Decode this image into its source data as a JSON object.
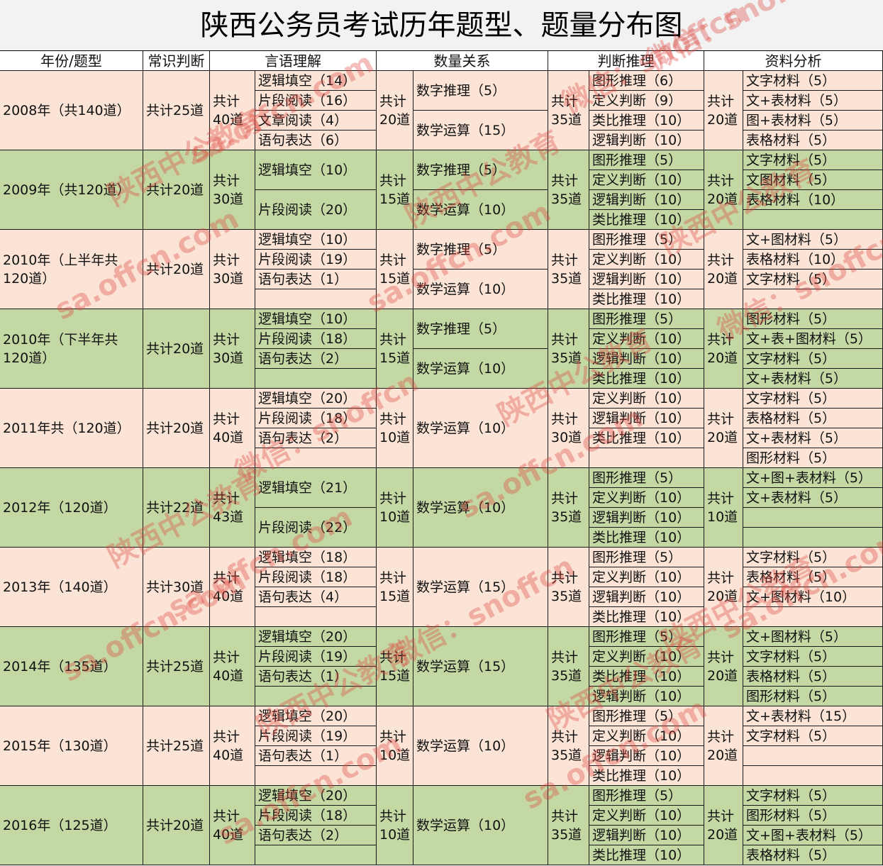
{
  "title": "陕西公务员考试历年题型、题量分布图",
  "headers": [
    "年份/题型",
    "常识判断",
    "言语理解",
    "数量关系",
    "判断推理",
    "资料分析"
  ],
  "colors": {
    "pink": "#fbe4d6",
    "green": "#c4d8a4"
  },
  "watermarks": [
    "陕西中公教育",
    "sa.offcn.com",
    "微信：snoffcn"
  ],
  "rows": [
    {
      "year": "2008年（共140道）",
      "common": "共计25道",
      "verbal_total": "共计40道",
      "verbal": [
        "逻辑填空（14）",
        "片段阅读（16）",
        "文章阅读（4）",
        "语句表达（6）"
      ],
      "quant_total": "共计20道",
      "quant": [
        "数字推理（5）",
        "数学运算（15）"
      ],
      "judge_total": "共计35道",
      "judge": [
        "图形推理（6）",
        "定义判断（9）",
        "类比推理（10）",
        "逻辑判断（10）"
      ],
      "data_total": "共计20道",
      "data": [
        "文字材料（5）",
        "文+表材料（5）",
        "图+表材料（5）",
        "表格材料（5）"
      ]
    },
    {
      "year": "2009年（共120道）",
      "common": "共计20道",
      "verbal_total": "共计30道",
      "verbal": [
        "逻辑填空（10）",
        "片段阅读（20）"
      ],
      "quant_total": "共计15道",
      "quant": [
        "数字推理（5）",
        "数学运算（10）"
      ],
      "judge_total": "共计35道",
      "judge": [
        "图形推理（5）",
        "定义判断（10）",
        "逻辑判断（10）",
        "类比推理（10）"
      ],
      "data_total": "共计20道",
      "data": [
        "文字材料（5）",
        "文图材料（5）",
        "表格材料（10）",
        ""
      ]
    },
    {
      "year": "2010年（上半年共120道）",
      "common": "共计20道",
      "verbal_total": "共计30道",
      "verbal": [
        "逻辑填空（10）",
        "片段阅读（19）",
        "语句表达（1）",
        ""
      ],
      "quant_total": "共计15道",
      "quant": [
        "数字推理（5）",
        "数学运算（10）"
      ],
      "judge_total": "共计35道",
      "judge": [
        "图形推理（5）",
        "定义判断（10）",
        "逻辑判断（10）",
        "类比推理（10）"
      ],
      "data_total": "共计20道",
      "data": [
        "文+图材料（5）",
        "表格材料（10）",
        "文字材料（5）",
        ""
      ]
    },
    {
      "year": "2010年（下半年共120道）",
      "common": "共计20道",
      "verbal_total": "共计30道",
      "verbal": [
        "逻辑填空（10）",
        "片段阅读（18）",
        "语句表达（2）",
        ""
      ],
      "quant_total": "共计15道",
      "quant": [
        "数字推理（5）",
        "数学运算（10）"
      ],
      "judge_total": "共计35道",
      "judge": [
        "图形推理（5）",
        "定义判断（10）",
        "逻辑判断（10）",
        "类比推理（10）"
      ],
      "data_total": "共计20道",
      "data": [
        "图形材料（5）",
        "文+表+图材料（5）",
        "文字材料（5）",
        "文+表材料（5）"
      ]
    },
    {
      "year": "2011年共（120道）",
      "common": "共计20道",
      "verbal_total": "共计40道",
      "verbal": [
        "逻辑填空（20）",
        "片段阅读（18）",
        "语句表达（2）",
        ""
      ],
      "quant_total": "共计10道",
      "quant": [
        "数学运算（10）"
      ],
      "judge_total": "共计30道",
      "judge": [
        "定义判断（10）",
        "逻辑判断（10）",
        "类比推理（10）",
        ""
      ],
      "data_total": "共计20道",
      "data": [
        "文字材料（5）",
        "表格材料（5）",
        "文+表材料（5）",
        "图形材料（5）"
      ]
    },
    {
      "year": "2012年（120道）",
      "common": "共计22道",
      "verbal_total": "共计43道",
      "verbal": [
        "逻辑填空（21）",
        "片段阅读（22）"
      ],
      "quant_total": "共计10道",
      "quant": [
        "数学运算（10）"
      ],
      "judge_total": "共计35道",
      "judge": [
        "图形推理（5）",
        "定义判断（10）",
        "逻辑判断（10）",
        "类比推理（10）"
      ],
      "data_total": "共计10道",
      "data": [
        "文+图+表材料（5）",
        "文+表材料（5）",
        "",
        ""
      ]
    },
    {
      "year": "2013年（140道）",
      "common": "共计30道",
      "verbal_total": "共计40道",
      "verbal": [
        "逻辑填空（18）",
        "片段阅读（18）",
        "语句表达（4）",
        ""
      ],
      "quant_total": "共计15道",
      "quant": [
        "数学运算（15）"
      ],
      "judge_total": "共计35道",
      "judge": [
        "图形推理（5）",
        "定义判断（10）",
        "逻辑判断（10）",
        "类比推理（10）"
      ],
      "data_total": "共计20道",
      "data": [
        "文字材料（5）",
        "表格材料（5）",
        "文+图材料（10）",
        ""
      ]
    },
    {
      "year": "2014年（135道）",
      "common": "共计25道",
      "verbal_total": "共计40道",
      "verbal": [
        "逻辑填空（20）",
        "片段阅读（19）",
        "语句表达（1）",
        ""
      ],
      "quant_total": "共计15道",
      "quant": [
        "数学运算（15）"
      ],
      "judge_total": "共计35道",
      "judge": [
        "图形推理（5）",
        "定义判断（10）",
        "类比推理（10）",
        "逻辑判断（10）"
      ],
      "data_total": "共计20道",
      "data": [
        "文+图材料（5）",
        "文字材料（5）",
        "表格材料（5）",
        "图形材料（5）"
      ]
    },
    {
      "year": "2015年（130道）",
      "common": "共计25道",
      "verbal_total": "共计40道",
      "verbal": [
        "逻辑填空（20）",
        "片段阅读（19）",
        "语句表达（1）",
        ""
      ],
      "quant_total": "共计10道",
      "quant": [
        "数学运算（10）"
      ],
      "judge_total": "共计35道",
      "judge": [
        "图形推理（5）",
        "定义判断（10）",
        "逻辑判断（10）",
        "类比推理（10）"
      ],
      "data_total": "共计20道",
      "data": [
        "文+表材料（15）",
        "文字材料（5）",
        "",
        ""
      ]
    },
    {
      "year": "2016年（125道）",
      "common": "共计20道",
      "verbal_total": "共计40道",
      "verbal": [
        "逻辑填空（20）",
        "片段阅读（18）",
        "语句表达（2）",
        ""
      ],
      "quant_total": "共计10道",
      "quant": [
        "数学运算（10）"
      ],
      "judge_total": "共计35道",
      "judge": [
        "图形推理（5）",
        "定义判断（10）",
        "逻辑判断（10）",
        "类比推理（10）"
      ],
      "data_total": "共计20道",
      "data": [
        "文字材料（5）",
        "图形材料（5）",
        "文+图+表材料（5）",
        "表格材料（5）"
      ]
    }
  ]
}
